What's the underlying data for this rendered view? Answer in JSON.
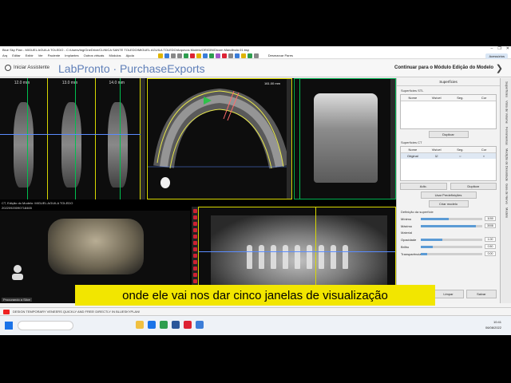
{
  "window": {
    "title": "Blue Sky Plan - MIGUEL AGUILA TOLEDO - C:/Users/tng/OneDrive/CLINICA SANTE TOLEDO/MIGUEL AGUILA TOLEDO/Arquivos Modelo/ORIGIN/Dicom Mandibula 01.bsp",
    "controls": [
      "–",
      "❐",
      "✕"
    ]
  },
  "menu": {
    "items": [
      "Arq",
      "Editar",
      "Exibir",
      "Ver",
      "Paciente",
      "Implantes",
      "Outros virtuais",
      "Módulos",
      "Ajuda"
    ],
    "right_label": "Acessórios",
    "tool_label": "Desmarcar Pares"
  },
  "header": {
    "assistant": "Iniciar Assistente",
    "brand": "LabPronto · PurchaseExports",
    "next": "Continuar para o Módulo Edição do Modelo"
  },
  "views": {
    "cross_labels": [
      "12.0 mm",
      "13.0 mm",
      "14.0 mm"
    ],
    "axial_label": "161.00 mm",
    "status_text": "CT, Edição do Modelo: MIGUEL AGUILA TOLEDO",
    "status_id": "20220920090718465",
    "bottom_mini": "Procurando a Slice"
  },
  "panel": {
    "title": "Superfícies",
    "surfaces_label": "Superfícies STL",
    "table1_headers": [
      "Nome",
      "Visível",
      "Seg.",
      "Cor"
    ],
    "btn_duplicate1": "Duplicar",
    "ct_label": "Superfícies CT",
    "table2_headers": [
      "Nome",
      "Visível",
      "Seg.",
      "Cor"
    ],
    "row_name": "Original",
    "btn_add": "Adic.",
    "btn_duplicate2": "Duplicar",
    "btn_load": "Usar Predefinições",
    "btn_save": "Criar modelo",
    "def_label": "Definição da superfície",
    "sliders": [
      {
        "label": "Mínimo",
        "value": "1150",
        "fill": 0.45
      },
      {
        "label": "Máximo",
        "value": "3008",
        "fill": 0.9
      }
    ],
    "material_label": "Material",
    "material_sliders": [
      {
        "label": "Opacidade",
        "value": "1.00",
        "fill": 0.35
      },
      {
        "label": "Brilho",
        "value": "0.50",
        "fill": 0.2
      },
      {
        "label": "Transparência",
        "value": "0.00",
        "fill": 0.1
      }
    ],
    "bottom_buttons": [
      "Definir todos",
      "Limpar",
      "Salvar"
    ]
  },
  "right_tabs": [
    "Superfícies",
    "Vista de Volume",
    "Ferramentas",
    "Medição de Densidade",
    "Guia de Nervo",
    "Modelo"
  ],
  "caption": "onde ele vai nos dar cinco janelas de visualização",
  "notification": "DESIGN TEMPORARY VENEERS QUICKLY AND FREE! DIRECTLY IN BLUESKYPLAN!",
  "taskbar": {
    "time": "10:41",
    "date": "06/08/2022"
  },
  "colors": {
    "slice_frame": "#d8d800",
    "caption_bg": "#f2e600",
    "brand": "#5f7fb8"
  }
}
